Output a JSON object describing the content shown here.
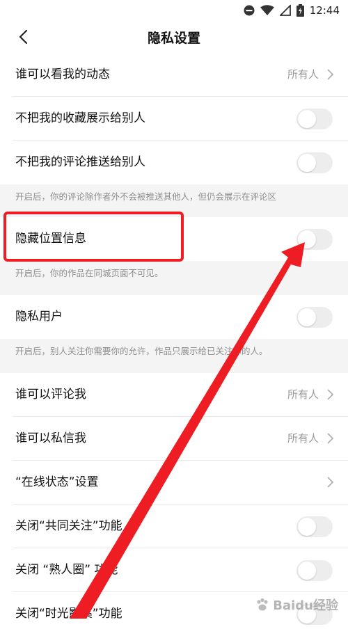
{
  "status_bar": {
    "time": "12:44",
    "icons": [
      "do-not-disturb-icon",
      "wifi-icon",
      "no-signal-icon",
      "battery-icon"
    ]
  },
  "header": {
    "title": "隐私设置",
    "back_icon": "back-chevron-icon"
  },
  "settings": {
    "who_can_see": {
      "label": "谁可以看我的动态",
      "value": "所有人"
    },
    "hide_favorites": {
      "label": "不把我的收藏展示给别人",
      "enabled": false
    },
    "hide_comments": {
      "label": "不把我的评论推送给别人",
      "enabled": false
    },
    "comments_note": "开启后，你的评论除作者外不会被推送其他人，但仍会展示在评论区",
    "hide_location": {
      "label": "隐藏位置信息",
      "enabled": false
    },
    "location_note": "开启后，你的作品在同城页面不可见。",
    "private_user": {
      "label": "隐私用户",
      "enabled": false
    },
    "private_note": "开启后，别人关注你需要你的允许，作品只展示给已关注你的人。",
    "who_can_comment": {
      "label": "谁可以评论我",
      "value": "所有人"
    },
    "who_can_message": {
      "label": "谁可以私信我",
      "value": "所有人"
    },
    "online_status": {
      "label": "“在线状态”设置"
    },
    "mutual_follow": {
      "label": "关闭“共同关注”功能",
      "enabled": false
    },
    "acquaintance_circle": {
      "label": "关闭 “熟人圈” 功能",
      "enabled": false
    },
    "time_album": {
      "label": "关闭“时光影集”功能",
      "enabled": false
    }
  },
  "colors": {
    "annotation_red": "#ee1d23",
    "toggle_off": "#ededed",
    "value_gray": "#9a9a9a"
  },
  "watermark": "Baidu经验"
}
